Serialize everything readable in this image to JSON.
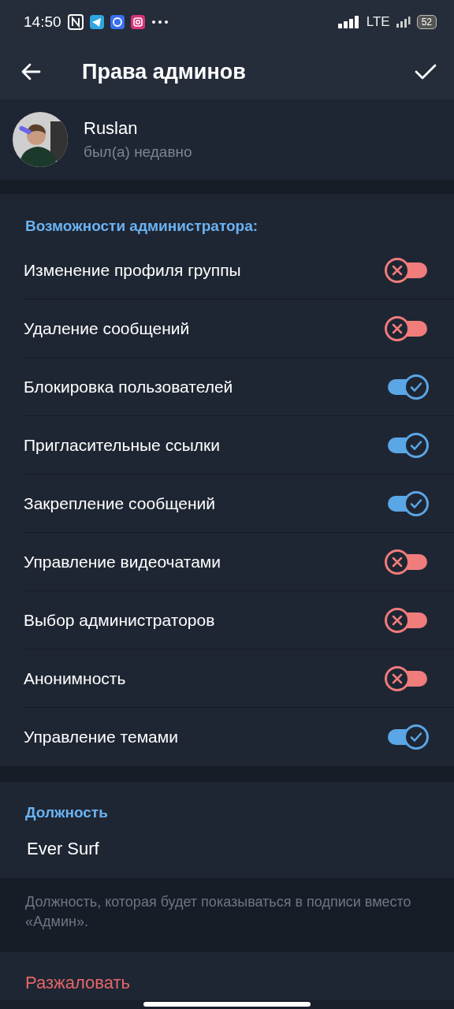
{
  "status_bar": {
    "time": "14:50",
    "network": "LTE",
    "battery": "52"
  },
  "header": {
    "title": "Права админов"
  },
  "user": {
    "name": "Ruslan",
    "status": "был(а) недавно"
  },
  "permissions": {
    "title": "Возможности администратора:",
    "items": [
      {
        "label": "Изменение профиля группы",
        "on": false
      },
      {
        "label": "Удаление сообщений",
        "on": false
      },
      {
        "label": "Блокировка пользователей",
        "on": true
      },
      {
        "label": "Пригласительные ссылки",
        "on": true
      },
      {
        "label": "Закрепление сообщений",
        "on": true
      },
      {
        "label": "Управление видеочатами",
        "on": false
      },
      {
        "label": "Выбор администраторов",
        "on": false
      },
      {
        "label": "Анонимность",
        "on": false
      },
      {
        "label": "Управление темами",
        "on": true
      }
    ]
  },
  "position": {
    "title": "Должность",
    "value": "Ever Surf",
    "hint": "Должность, которая будет показываться в подписи вместо «Админ»."
  },
  "dismiss": {
    "label": "Разжаловать"
  }
}
